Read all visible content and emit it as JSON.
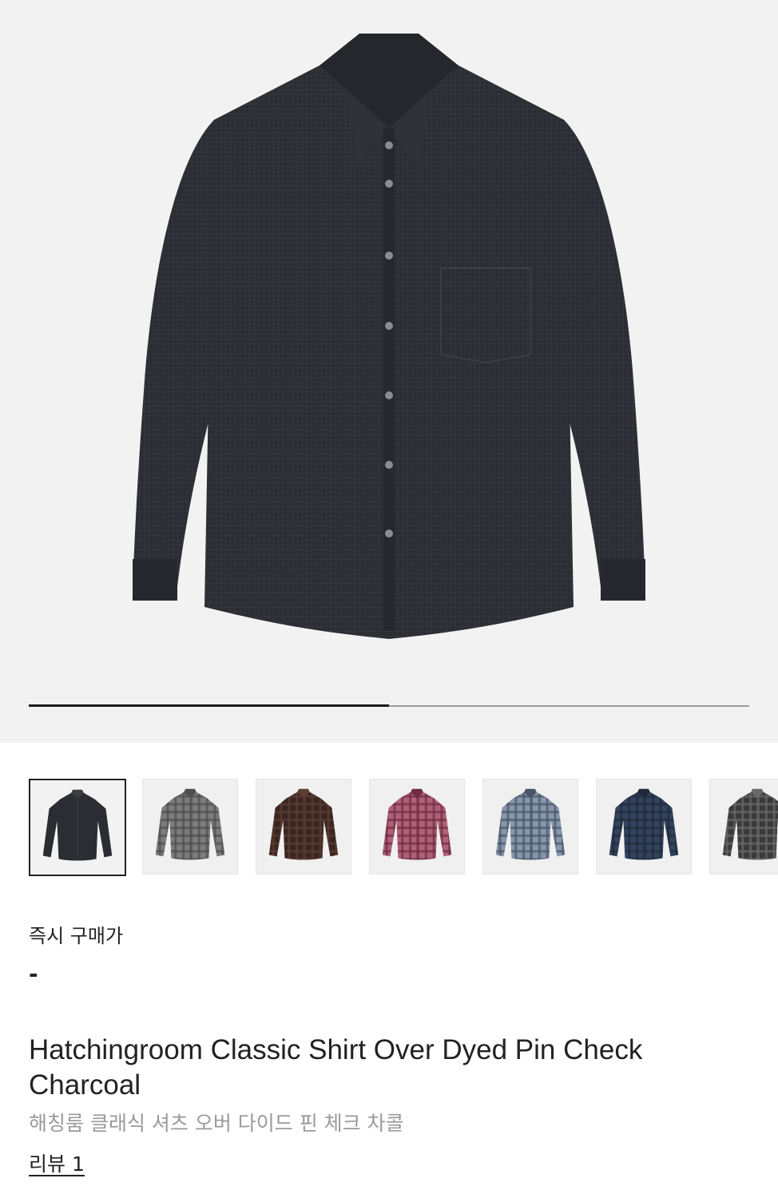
{
  "gallery": {
    "main_image_alt": "charcoal-shirt-photo",
    "progress_fraction": 0.5,
    "thumbnails": [
      {
        "name": "charcoal",
        "body": "#2b2d33",
        "check": "#3a3c42",
        "selected": true
      },
      {
        "name": "grey",
        "body": "#7c7c7c",
        "check": "#4f4f4f",
        "selected": false
      },
      {
        "name": "brown",
        "body": "#3a2620",
        "check": "#5c3d33",
        "selected": false
      },
      {
        "name": "pink",
        "body": "#b0607a",
        "check": "#6e2d42",
        "selected": false
      },
      {
        "name": "light-blue",
        "body": "#8796ab",
        "check": "#4a5668",
        "selected": false
      },
      {
        "name": "navy",
        "body": "#34435c",
        "check": "#1f2a3c",
        "selected": false
      },
      {
        "name": "black-check",
        "body": "#3a3a3a",
        "check": "#6a6a6a",
        "selected": false
      }
    ]
  },
  "price": {
    "label": "즉시 구매가",
    "value": "-"
  },
  "product": {
    "title_en": "Hatchingroom Classic Shirt Over Dyed Pin Check Charcoal",
    "title_ko": "해칭룸 클래식 셔츠 오버 다이드 핀 체크 차콜"
  },
  "review": {
    "label": "리뷰 1"
  }
}
